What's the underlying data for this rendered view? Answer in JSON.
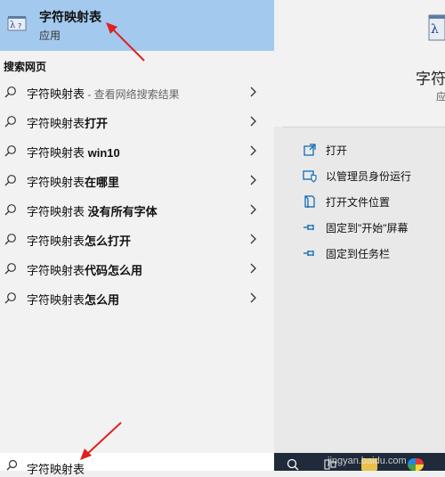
{
  "best_match": {
    "app_name": "字符映射表",
    "app_type": "应用"
  },
  "section_label": "搜索网页",
  "suggestions": [
    {
      "prefix": "字符映射表",
      "bold": "",
      "hint": " - 查看网络搜索结果"
    },
    {
      "prefix": "字符映射表",
      "bold": "打开",
      "hint": ""
    },
    {
      "prefix": "字符映射表 ",
      "bold": "win10",
      "hint": ""
    },
    {
      "prefix": "字符映射表",
      "bold": "在哪里",
      "hint": ""
    },
    {
      "prefix": "字符映射表 ",
      "bold": "没有所有字体",
      "hint": ""
    },
    {
      "prefix": "字符映射表",
      "bold": "怎么打开",
      "hint": ""
    },
    {
      "prefix": "字符映射表",
      "bold": "代码怎么用",
      "hint": ""
    },
    {
      "prefix": "字符映射表",
      "bold": "怎么用",
      "hint": ""
    }
  ],
  "right_panel": {
    "app_name": "字符",
    "app_type": "应"
  },
  "actions": [
    {
      "label": "打开",
      "icon": "open-icon"
    },
    {
      "label": "以管理员身份运行",
      "icon": "shield-icon"
    },
    {
      "label": "打开文件位置",
      "icon": "file-location-icon"
    },
    {
      "label": "固定到\"开始\"屏幕",
      "icon": "pin-icon"
    },
    {
      "label": "固定到任务栏",
      "icon": "pin-icon"
    }
  ],
  "search_box": {
    "value": "字符映射表"
  },
  "taskbar": {
    "watermark": "jingyan.baidu.com"
  },
  "colors": {
    "selected": "#a3c9ee",
    "accent": "#0063b1",
    "arrow": "#e02020"
  }
}
